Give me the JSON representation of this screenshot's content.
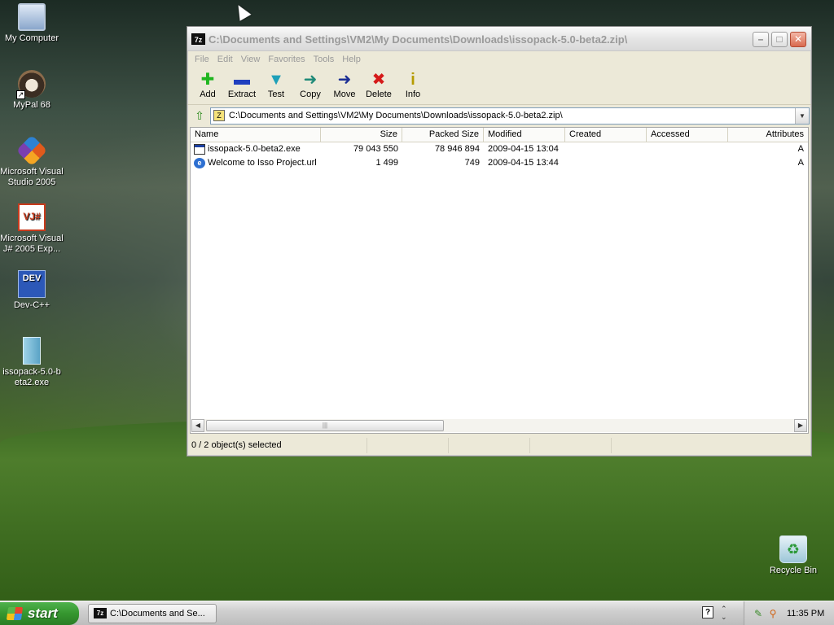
{
  "desktop": {
    "icons": [
      {
        "label": "My Computer"
      },
      {
        "label": "MyPal 68"
      },
      {
        "label": "Microsoft Visual Studio 2005"
      },
      {
        "label": "Microsoft Visual J# 2005 Exp..."
      },
      {
        "label": "Dev-C++"
      },
      {
        "label": "issopack-5.0-beta2.exe"
      },
      {
        "label": "Recycle Bin"
      }
    ],
    "icon_glyphs": {
      "vj": "VJ#",
      "dev": "DEV"
    }
  },
  "window": {
    "app_badge": "7z",
    "title": "C:\\Documents and Settings\\VM2\\My Documents\\Downloads\\issopack-5.0-beta2.zip\\",
    "controls": {
      "minimize": "–",
      "maximize": "□",
      "close": "✕"
    },
    "menu": [
      "File",
      "Edit",
      "View",
      "Favorites",
      "Tools",
      "Help"
    ],
    "toolbar": [
      {
        "label": "Add",
        "glyph": "✚",
        "icon": "add-icon"
      },
      {
        "label": "Extract",
        "glyph": "▬",
        "icon": "extract-icon"
      },
      {
        "label": "Test",
        "glyph": "▼",
        "icon": "test-icon"
      },
      {
        "label": "Copy",
        "glyph": "➜",
        "icon": "copy-icon"
      },
      {
        "label": "Move",
        "glyph": "➜",
        "icon": "move-icon"
      },
      {
        "label": "Delete",
        "glyph": "✖",
        "icon": "delete-icon"
      },
      {
        "label": "Info",
        "glyph": "i",
        "icon": "info-icon"
      }
    ],
    "address": {
      "path": "C:\\Documents and Settings\\VM2\\My Documents\\Downloads\\issopack-5.0-beta2.zip\\"
    },
    "columns": [
      "Name",
      "Size",
      "Packed Size",
      "Modified",
      "Created",
      "Accessed",
      "Attributes"
    ],
    "files": [
      {
        "name": "issopack-5.0-beta2.exe",
        "size": "79 043 550",
        "packed": "78 946 894",
        "modified": "2009-04-15 13:04",
        "created": "",
        "accessed": "",
        "attrs": "A"
      },
      {
        "name": "Welcome to Isso Project.url",
        "size": "1 499",
        "packed": "749",
        "modified": "2009-04-15 13:44",
        "created": "",
        "accessed": "",
        "attrs": "A"
      }
    ],
    "status": "0 / 2 object(s) selected"
  },
  "taskbar": {
    "start_label": "start",
    "task": {
      "badge": "7z",
      "label": "C:\\Documents and Se..."
    },
    "clock": "11:35 PM"
  },
  "colors": {
    "start_green": "#35962f",
    "window_bg": "#ece9d8",
    "close_red": "#d96a4f"
  }
}
